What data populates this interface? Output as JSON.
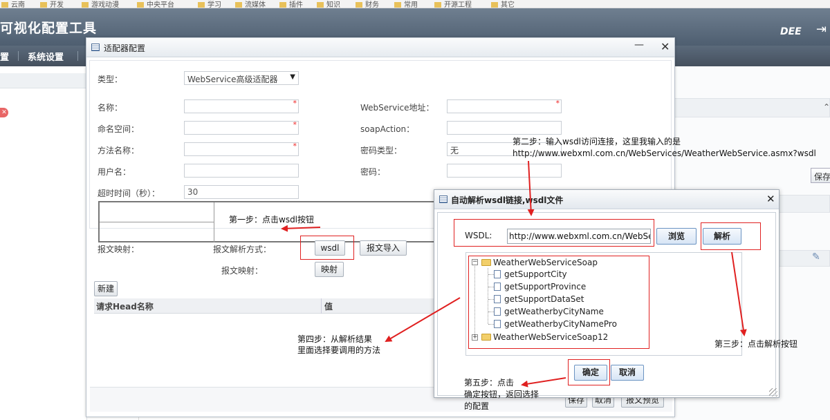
{
  "bookmarks": [
    "云南",
    "开发",
    "游戏动漫",
    "中央平台",
    "学习",
    "流媒体",
    "插件",
    "知识",
    "财务",
    "常用",
    "开源工程",
    "其它"
  ],
  "app": {
    "title": "可视化配置工具",
    "brand": "DEE",
    "nav": [
      "置",
      "系统设置"
    ]
  },
  "background": {
    "save_label": "保存"
  },
  "adapter_dialog": {
    "title": "适配器配置",
    "type_label": "类型：",
    "type_value": "WebService高级适配器",
    "name_label": "名称：",
    "namespace_label": "命名空间：",
    "method_label": "方法名称：",
    "username_label": "用户名：",
    "timeout_label": "超时时间（秒）：",
    "timeout_value": "30",
    "ws_address_label": "WebService地址：",
    "soap_action_label": "soapAction：",
    "pwd_type_label": "密码类型：",
    "pwd_type_value": "无",
    "password_label": "密码：",
    "msg_mapping_label": "报文映射：",
    "parse_method_label": "报文解析方式：",
    "wsdl_button": "wsdl",
    "import_button": "报文导入",
    "mapping_row_label": "报文映射：",
    "mapping_button": "映射",
    "new_button": "新建",
    "head_columns": [
      "请求Head名称",
      "值"
    ],
    "footer_buttons": [
      "保存",
      "取消",
      "报文预览"
    ]
  },
  "wsdl_dialog": {
    "title": "自动解析wsdl链接,wsdl文件",
    "wsdl_label": "WSDL:",
    "wsdl_value": "http://www.webxml.com.cn/WebServices/WeatherWebService.asmx?wsdl",
    "browse_button": "浏览",
    "parse_button": "解析",
    "tree": {
      "root": "WeatherWebServiceSoap",
      "methods": [
        "getSupportCity",
        "getSupportProvince",
        "getSupportDataSet",
        "getWeatherbyCityName",
        "getWeatherbyCityNamePro"
      ],
      "collapsed": "WeatherWebServiceSoap12"
    },
    "ok_button": "确定",
    "cancel_button": "取消"
  },
  "annotations": {
    "step1": "第一步：点击wsdl按钮",
    "step2_line1": "第二步：输入wsdl访问连接，这里我输入的是",
    "step2_line2": "http://www.webxml.com.cn/WebServices/WeatherWebService.asmx?wsdl",
    "step3": "第三步：点击解析按钮",
    "step4_line1": "第四步：从解析结果",
    "step4_line2": "里面选择要调用的方法",
    "step5_line1": "第五步：点击",
    "step5_line2": "确定按钮，返回选择",
    "step5_line3": "的配置",
    "annotation_color": "#e02020"
  }
}
